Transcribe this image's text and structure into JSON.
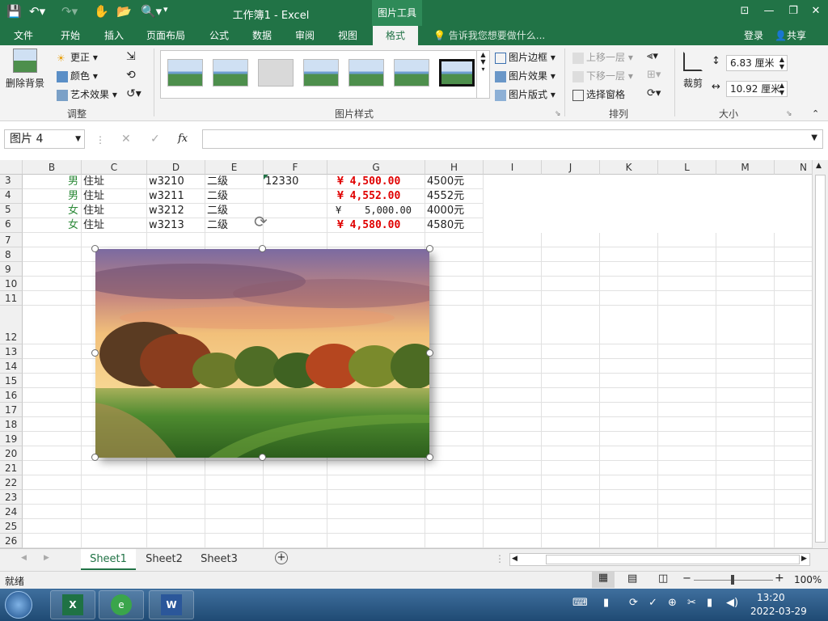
{
  "window": {
    "title": "工作簿1 - Excel",
    "tool_context": "图片工具",
    "colors": {
      "accent": "#217346",
      "money_red": "#e00000",
      "gender_green": "#2e8a3a"
    }
  },
  "tabs": [
    {
      "label": "文件"
    },
    {
      "label": "开始"
    },
    {
      "label": "插入"
    },
    {
      "label": "页面布局"
    },
    {
      "label": "公式"
    },
    {
      "label": "数据"
    },
    {
      "label": "审阅"
    },
    {
      "label": "视图"
    },
    {
      "label": "格式"
    }
  ],
  "tellme": "告诉我您想要做什么...",
  "account": {
    "login": "登录",
    "share": "共享"
  },
  "ribbon": {
    "adjust": {
      "remove_bg": "删除背景",
      "corrections": "更正",
      "color": "颜色",
      "artistic": "艺术效果",
      "group": "调整"
    },
    "styles": {
      "group": "图片样式",
      "border": "图片边框",
      "effects": "图片效果",
      "layout": "图片版式"
    },
    "arrange": {
      "group": "排列",
      "bring_forward": "上移一层",
      "send_backward": "下移一层",
      "selection_pane": "选择窗格"
    },
    "size": {
      "group": "大小",
      "crop": "裁剪",
      "height": "6.83 厘米",
      "width": "10.92 厘米"
    }
  },
  "formula": {
    "name_box": "图片 4",
    "fx": "fx",
    "content": ""
  },
  "columns": [
    "B",
    "C",
    "D",
    "E",
    "F",
    "G",
    "H",
    "I",
    "J",
    "K",
    "L",
    "M",
    "N"
  ],
  "rows": [
    {
      "num": "3",
      "B": "男",
      "C": "住址",
      "D": "w3210",
      "E": "二级",
      "F": "12330",
      "G": "¥  4,500.00",
      "G_style": "red",
      "H": "4500元"
    },
    {
      "num": "4",
      "B": "男",
      "C": "住址",
      "D": "w3211",
      "E": "二级",
      "F": "",
      "G": "¥  4,552.00",
      "G_style": "red",
      "H": "4552元"
    },
    {
      "num": "5",
      "B": "女",
      "C": "住址",
      "D": "w3212",
      "E": "二级",
      "F": "",
      "G": "¥    5,000.00",
      "G_style": "plain",
      "H": "4000元"
    },
    {
      "num": "6",
      "B": "女",
      "C": "住址",
      "D": "w3213",
      "E": "二级",
      "F": "",
      "G": "¥  4,580.00",
      "G_style": "red",
      "H": "4580元"
    }
  ],
  "empty_rows": [
    "7",
    "8",
    "9",
    "10",
    "11",
    "12",
    "13",
    "14",
    "15",
    "16",
    "17",
    "18",
    "19",
    "20",
    "21",
    "22",
    "23",
    "24",
    "25",
    "26"
  ],
  "sheets": [
    {
      "label": "Sheet1"
    },
    {
      "label": "Sheet2"
    },
    {
      "label": "Sheet3"
    }
  ],
  "status": {
    "ready": "就绪",
    "zoom": "100%"
  },
  "taskbar": {
    "time": "13:20",
    "date": "2022-03-29"
  }
}
